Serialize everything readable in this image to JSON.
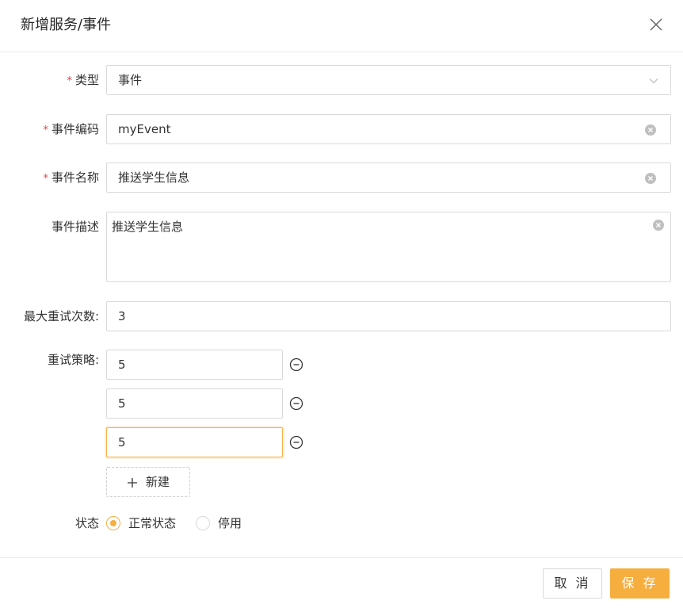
{
  "dialog": {
    "title": "新增服务/事件"
  },
  "form": {
    "type": {
      "label": "类型",
      "value": "事件"
    },
    "event_code": {
      "label": "事件编码",
      "value": "myEvent"
    },
    "event_name": {
      "label": "事件名称",
      "value": "推送学生信息"
    },
    "event_desc": {
      "label": "事件描述",
      "value": "推送学生信息"
    },
    "max_retry": {
      "label": "最大重试次数:",
      "value": "3"
    },
    "retry_strategy": {
      "label": "重试策略:",
      "items": [
        "5",
        "5",
        "5"
      ],
      "add_label": "新建"
    },
    "status": {
      "label": "状态",
      "options": [
        "正常状态",
        "停用"
      ],
      "selected": "正常状态"
    }
  },
  "footer": {
    "cancel_label": "取 消",
    "save_label": "保 存"
  },
  "icons": {
    "close": "close-icon",
    "chevron": "chevron-down-icon",
    "clear": "clear-icon",
    "remove": "minus-circle-icon",
    "add": "plus-icon"
  },
  "colors": {
    "accent": "#f6ae3f",
    "required": "#e0424a"
  }
}
